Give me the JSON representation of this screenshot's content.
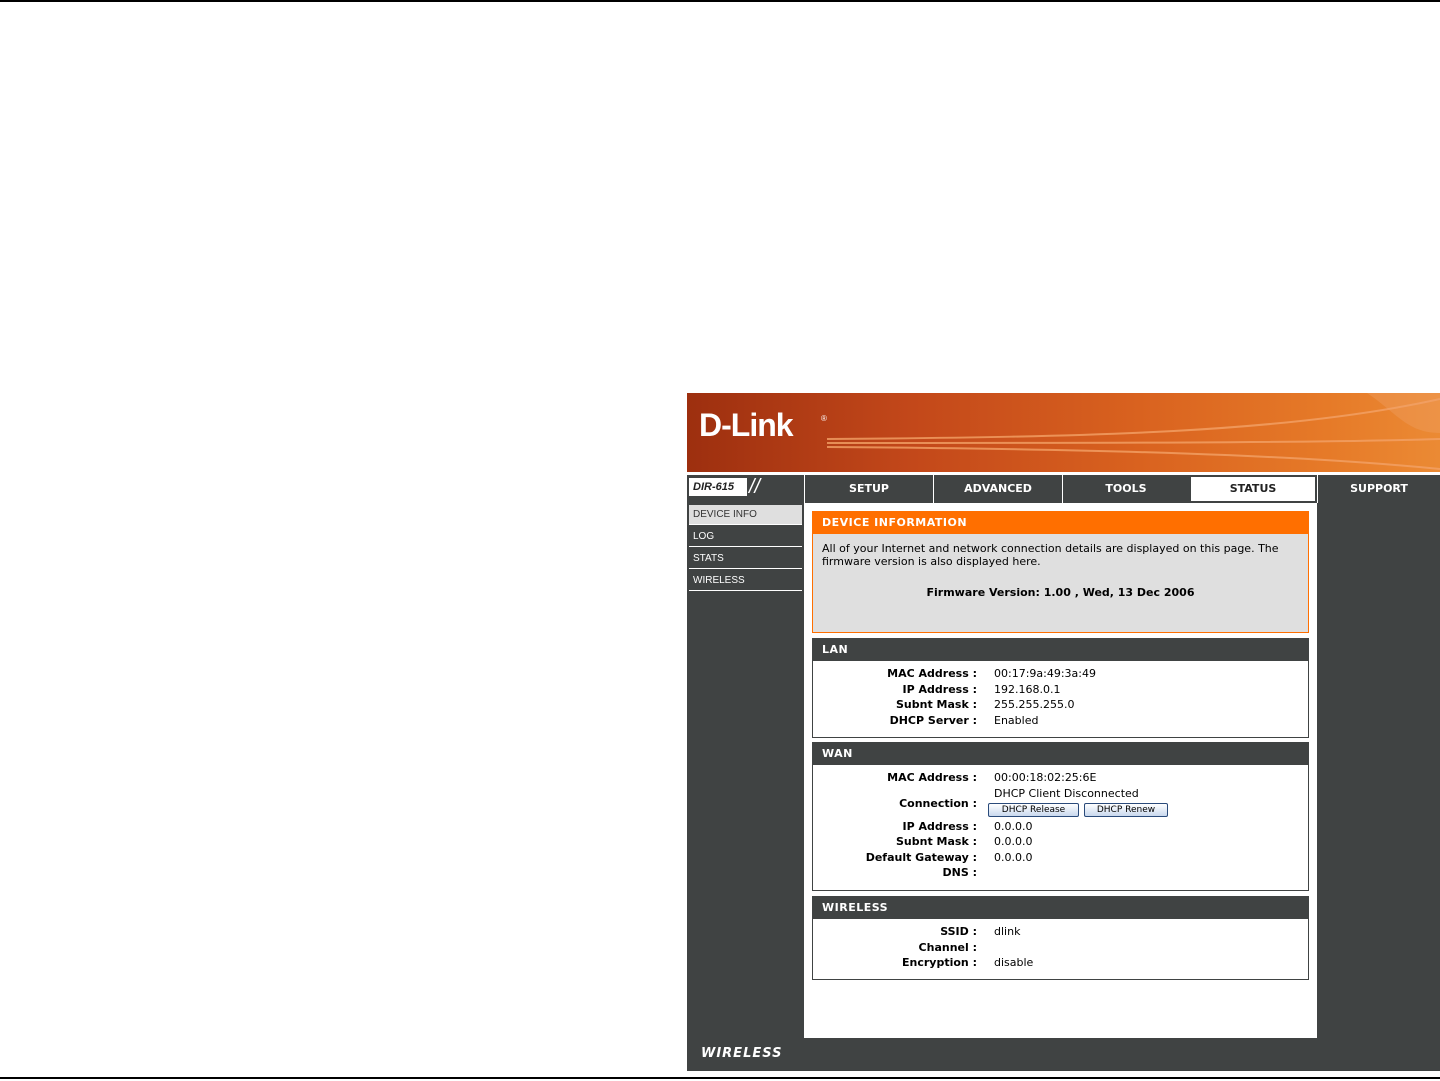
{
  "header": {
    "logo": "D-Link",
    "model": "DIR-615"
  },
  "nav": {
    "tabs": [
      {
        "label": "SETUP"
      },
      {
        "label": "ADVANCED"
      },
      {
        "label": "TOOLS"
      },
      {
        "label": "STATUS"
      },
      {
        "label": "SUPPORT"
      }
    ],
    "active_tab": "STATUS"
  },
  "sidebar": {
    "items": [
      {
        "label": "DEVICE INFO"
      },
      {
        "label": "LOG"
      },
      {
        "label": "STATS"
      },
      {
        "label": "WIRELESS"
      }
    ],
    "active_item": "DEVICE INFO"
  },
  "device_info": {
    "title": "DEVICE INFORMATION",
    "intro": "All of your Internet and network connection details are displayed on this page. The firmware version is also displayed here.",
    "firmware": "Firmware Version: 1.00 , Wed, 13 Dec 2006"
  },
  "lan": {
    "title": "LAN",
    "rows": [
      {
        "label": "MAC Address :",
        "value": "00:17:9a:49:3a:49"
      },
      {
        "label": "IP Address :",
        "value": "192.168.0.1"
      },
      {
        "label": "Subnt Mask :",
        "value": "255.255.255.0"
      },
      {
        "label": "DHCP Server :",
        "value": "Enabled"
      }
    ]
  },
  "wan": {
    "title": "WAN",
    "mac": {
      "label": "MAC Address :",
      "value": "00:00:18:02:25:6E"
    },
    "connection": {
      "label": "Connection :",
      "value": "DHCP Client Disconnected"
    },
    "buttons": {
      "release": "DHCP Release",
      "renew": "DHCP Renew"
    },
    "rows": [
      {
        "label": "IP Address :",
        "value": "0.0.0.0"
      },
      {
        "label": "Subnt Mask :",
        "value": "0.0.0.0"
      },
      {
        "label": "Default Gateway :",
        "value": "0.0.0.0"
      },
      {
        "label": "DNS :",
        "value": ""
      }
    ]
  },
  "wireless": {
    "title": "WIRELESS",
    "rows": [
      {
        "label": "SSID :",
        "value": "dlink"
      },
      {
        "label": "Channel :",
        "value": ""
      },
      {
        "label": "Encryption :",
        "value": "disable"
      }
    ]
  },
  "footer": {
    "text": "WIRELESS"
  },
  "colors": {
    "accent_orange": "#ff6f00",
    "dark_gray": "#404343",
    "panel_gray": "#dfdfdf"
  }
}
